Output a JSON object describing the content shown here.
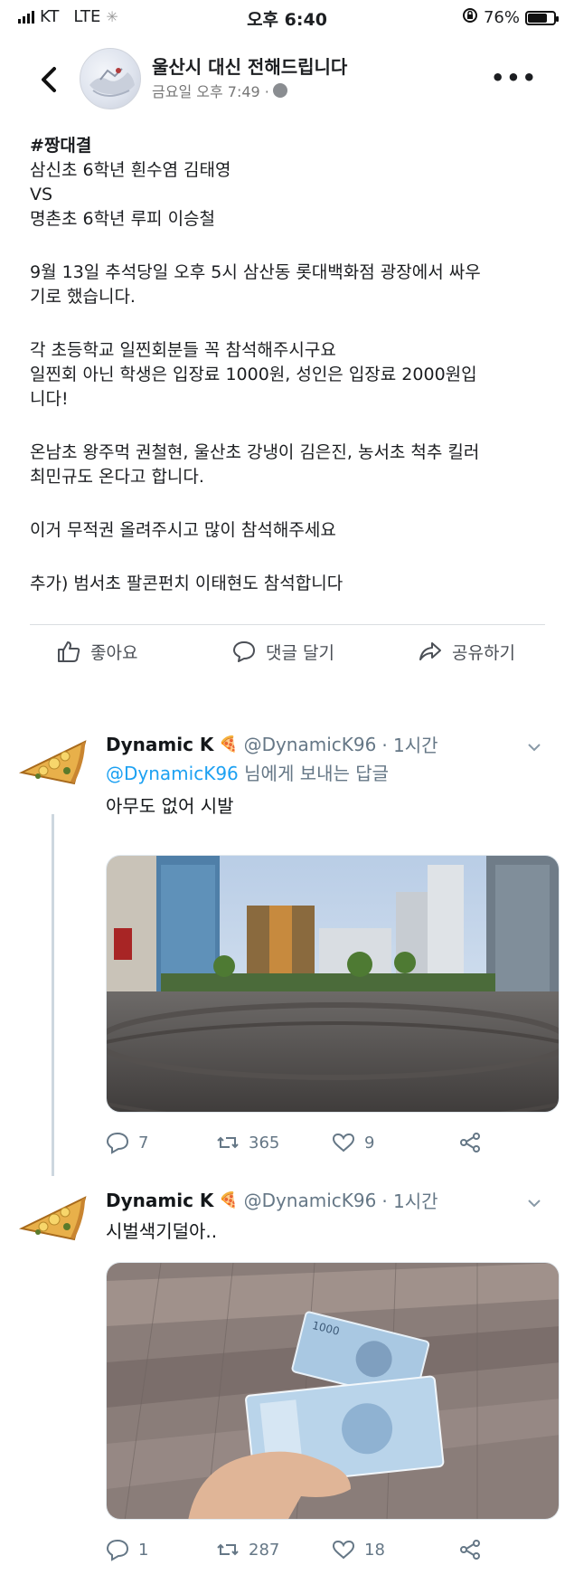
{
  "status_bar": {
    "carrier": "KT",
    "network": "LTE",
    "time": "오후 6:40",
    "battery_percent": "76%",
    "battery_level": 0.76
  },
  "post": {
    "page_name": "울산시 대신 전해드립니다",
    "timestamp": "금요일 오후 7:49 ·",
    "body": {
      "hashtag": "#짱대결",
      "line1": "삼신초 6학년 흰수염 김태영",
      "line2": "VS",
      "line3": "명촌초 6학년 루피 이승철",
      "para2_l1": "9월 13일 추석당일 오후 5시 삼산동 롯대백화점 광장에서 싸우",
      "para2_l2": "기로 했습니다.",
      "para3_l1": "각 초등학교 일찐회분들 꼭 참석해주시구요",
      "para3_l2": "일찐회 아닌 학생은 입장료 1000원, 성인은 입장료 2000원입",
      "para3_l3": "니다!",
      "para4_l1": "온남초 왕주먹 권철현, 울산초 강냉이 김은진, 농서초 척추 킬러",
      "para4_l2": "최민규도 온다고 합니다.",
      "para5": "이거 무적권 올려주시고 많이 참석해주세요",
      "para6": "추가) 범서초 팔콘펀치 이태현도 참석합니다"
    },
    "actions": {
      "like": "좋아요",
      "comment": "댓글 달기",
      "share": "공유하기"
    }
  },
  "tweets": [
    {
      "name": "Dynamic K",
      "name_emoji": "🍕",
      "handle": "@DynamicK96",
      "time": "· 1시간",
      "reply_mention": "@DynamicK96",
      "reply_suffix": " 님에게 보내는 답글",
      "text": "아무도 없어 시발",
      "replies": "7",
      "retweets": "365",
      "likes": "9"
    },
    {
      "name": "Dynamic K",
      "name_emoji": "🍕",
      "handle": "@DynamicK96",
      "time": "· 1시간",
      "text": "시벌색기덜아..",
      "banknote_label": "1000",
      "replies": "1",
      "retweets": "287",
      "likes": "18"
    }
  ],
  "colors": {
    "facebook_text": "#1c1e21",
    "twitter_link": "#1da1f2",
    "twitter_gray": "#657786"
  }
}
